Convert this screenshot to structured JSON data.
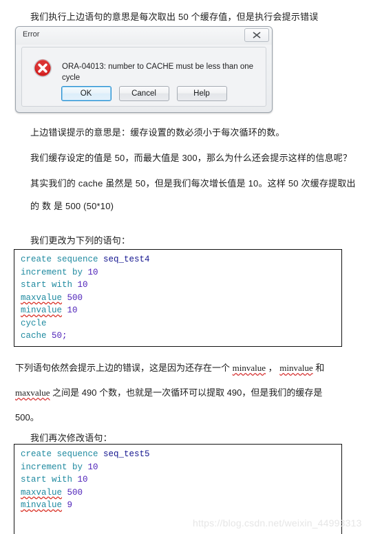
{
  "paragraphs": {
    "intro": "我们执行上边语句的意思是每次取出 50 个缓存值，但是执行会提示错误",
    "meaning": "上边错误提示的意思是：缓存设置的数必须小于每次循环的数。",
    "question": "我们缓存设定的值是 50，而最大值是 300，那么为什么还会提示这样的信息呢？",
    "explain_line1": "其实我们的 cache 虽然是 50，但是我们每次增长值是 10。这样 50 次缓存提取出",
    "explain_line2": "的 数 是 500  (50*10)",
    "change_intro": "我们更改为下列的语句：",
    "still_error_a": "下列语句依然会提示上边的错误，这是因为还存在一个 ",
    "still_error_b": " ， ",
    "still_error_c": " 和 ",
    "still_error_d": " 之间是 490 个数，也就是一次循环可以提取 490，但是我们的缓存是",
    "still_error_e": "500。",
    "modify_again": "我们再次修改语句："
  },
  "spellwords": {
    "minvalue": "minvalue",
    "maxvalue": "maxvalue"
  },
  "dialog": {
    "title": "Error",
    "close_icon": "close-x-icon",
    "error_icon": "error-circle-x-icon",
    "message": "ORA-04013: number to CACHE must be less than one cycle",
    "buttons": [
      {
        "label": "OK",
        "focused": true
      },
      {
        "label": "Cancel",
        "focused": false
      },
      {
        "label": "Help",
        "focused": false
      }
    ]
  },
  "code_blocks": [
    {
      "name": "seq_test4",
      "lines": [
        [
          {
            "t": "create sequence ",
            "c": "kw"
          },
          {
            "t": "seq_test4",
            "c": "ident"
          }
        ],
        [
          {
            "t": "increment by ",
            "c": "kw"
          },
          {
            "t": "10",
            "c": "num2"
          }
        ],
        [
          {
            "t": "start with ",
            "c": "kw"
          },
          {
            "t": "10",
            "c": "num2"
          }
        ],
        [
          {
            "t": "maxvalue",
            "c": "kw-spell"
          },
          {
            "t": " ",
            "c": "kw"
          },
          {
            "t": "500",
            "c": "num2"
          }
        ],
        [
          {
            "t": "minvalue",
            "c": "kw-spell"
          },
          {
            "t": " ",
            "c": "kw"
          },
          {
            "t": "10",
            "c": "num2"
          }
        ],
        [
          {
            "t": "cycle",
            "c": "kw"
          }
        ],
        [
          {
            "t": "cache ",
            "c": "kw"
          },
          {
            "t": "50",
            "c": "num2"
          },
          {
            "t": ";",
            "c": "punct"
          }
        ]
      ]
    },
    {
      "name": "seq_test5",
      "lines": [
        [
          {
            "t": "create sequence ",
            "c": "kw"
          },
          {
            "t": "seq_test5",
            "c": "ident"
          }
        ],
        [
          {
            "t": "increment by ",
            "c": "kw"
          },
          {
            "t": "10",
            "c": "num2"
          }
        ],
        [
          {
            "t": "start with ",
            "c": "kw"
          },
          {
            "t": "10",
            "c": "num2"
          }
        ],
        [
          {
            "t": "maxvalue",
            "c": "kw-spell"
          },
          {
            "t": " ",
            "c": "kw"
          },
          {
            "t": "500",
            "c": "num2"
          }
        ],
        [
          {
            "t": "minvalue",
            "c": "kw-spell"
          },
          {
            "t": " ",
            "c": "kw"
          },
          {
            "t": "9",
            "c": "num2"
          }
        ]
      ]
    }
  ],
  "watermark": "https://blog.csdn.net/weixin_44993313",
  "colors": {
    "keyword": "#1f8aa0",
    "identifier": "#13158f",
    "number": "#4e22b9",
    "spell_underline": "#d93025",
    "error_red": "#cc2222",
    "focus_blue": "#2a8fd0"
  }
}
